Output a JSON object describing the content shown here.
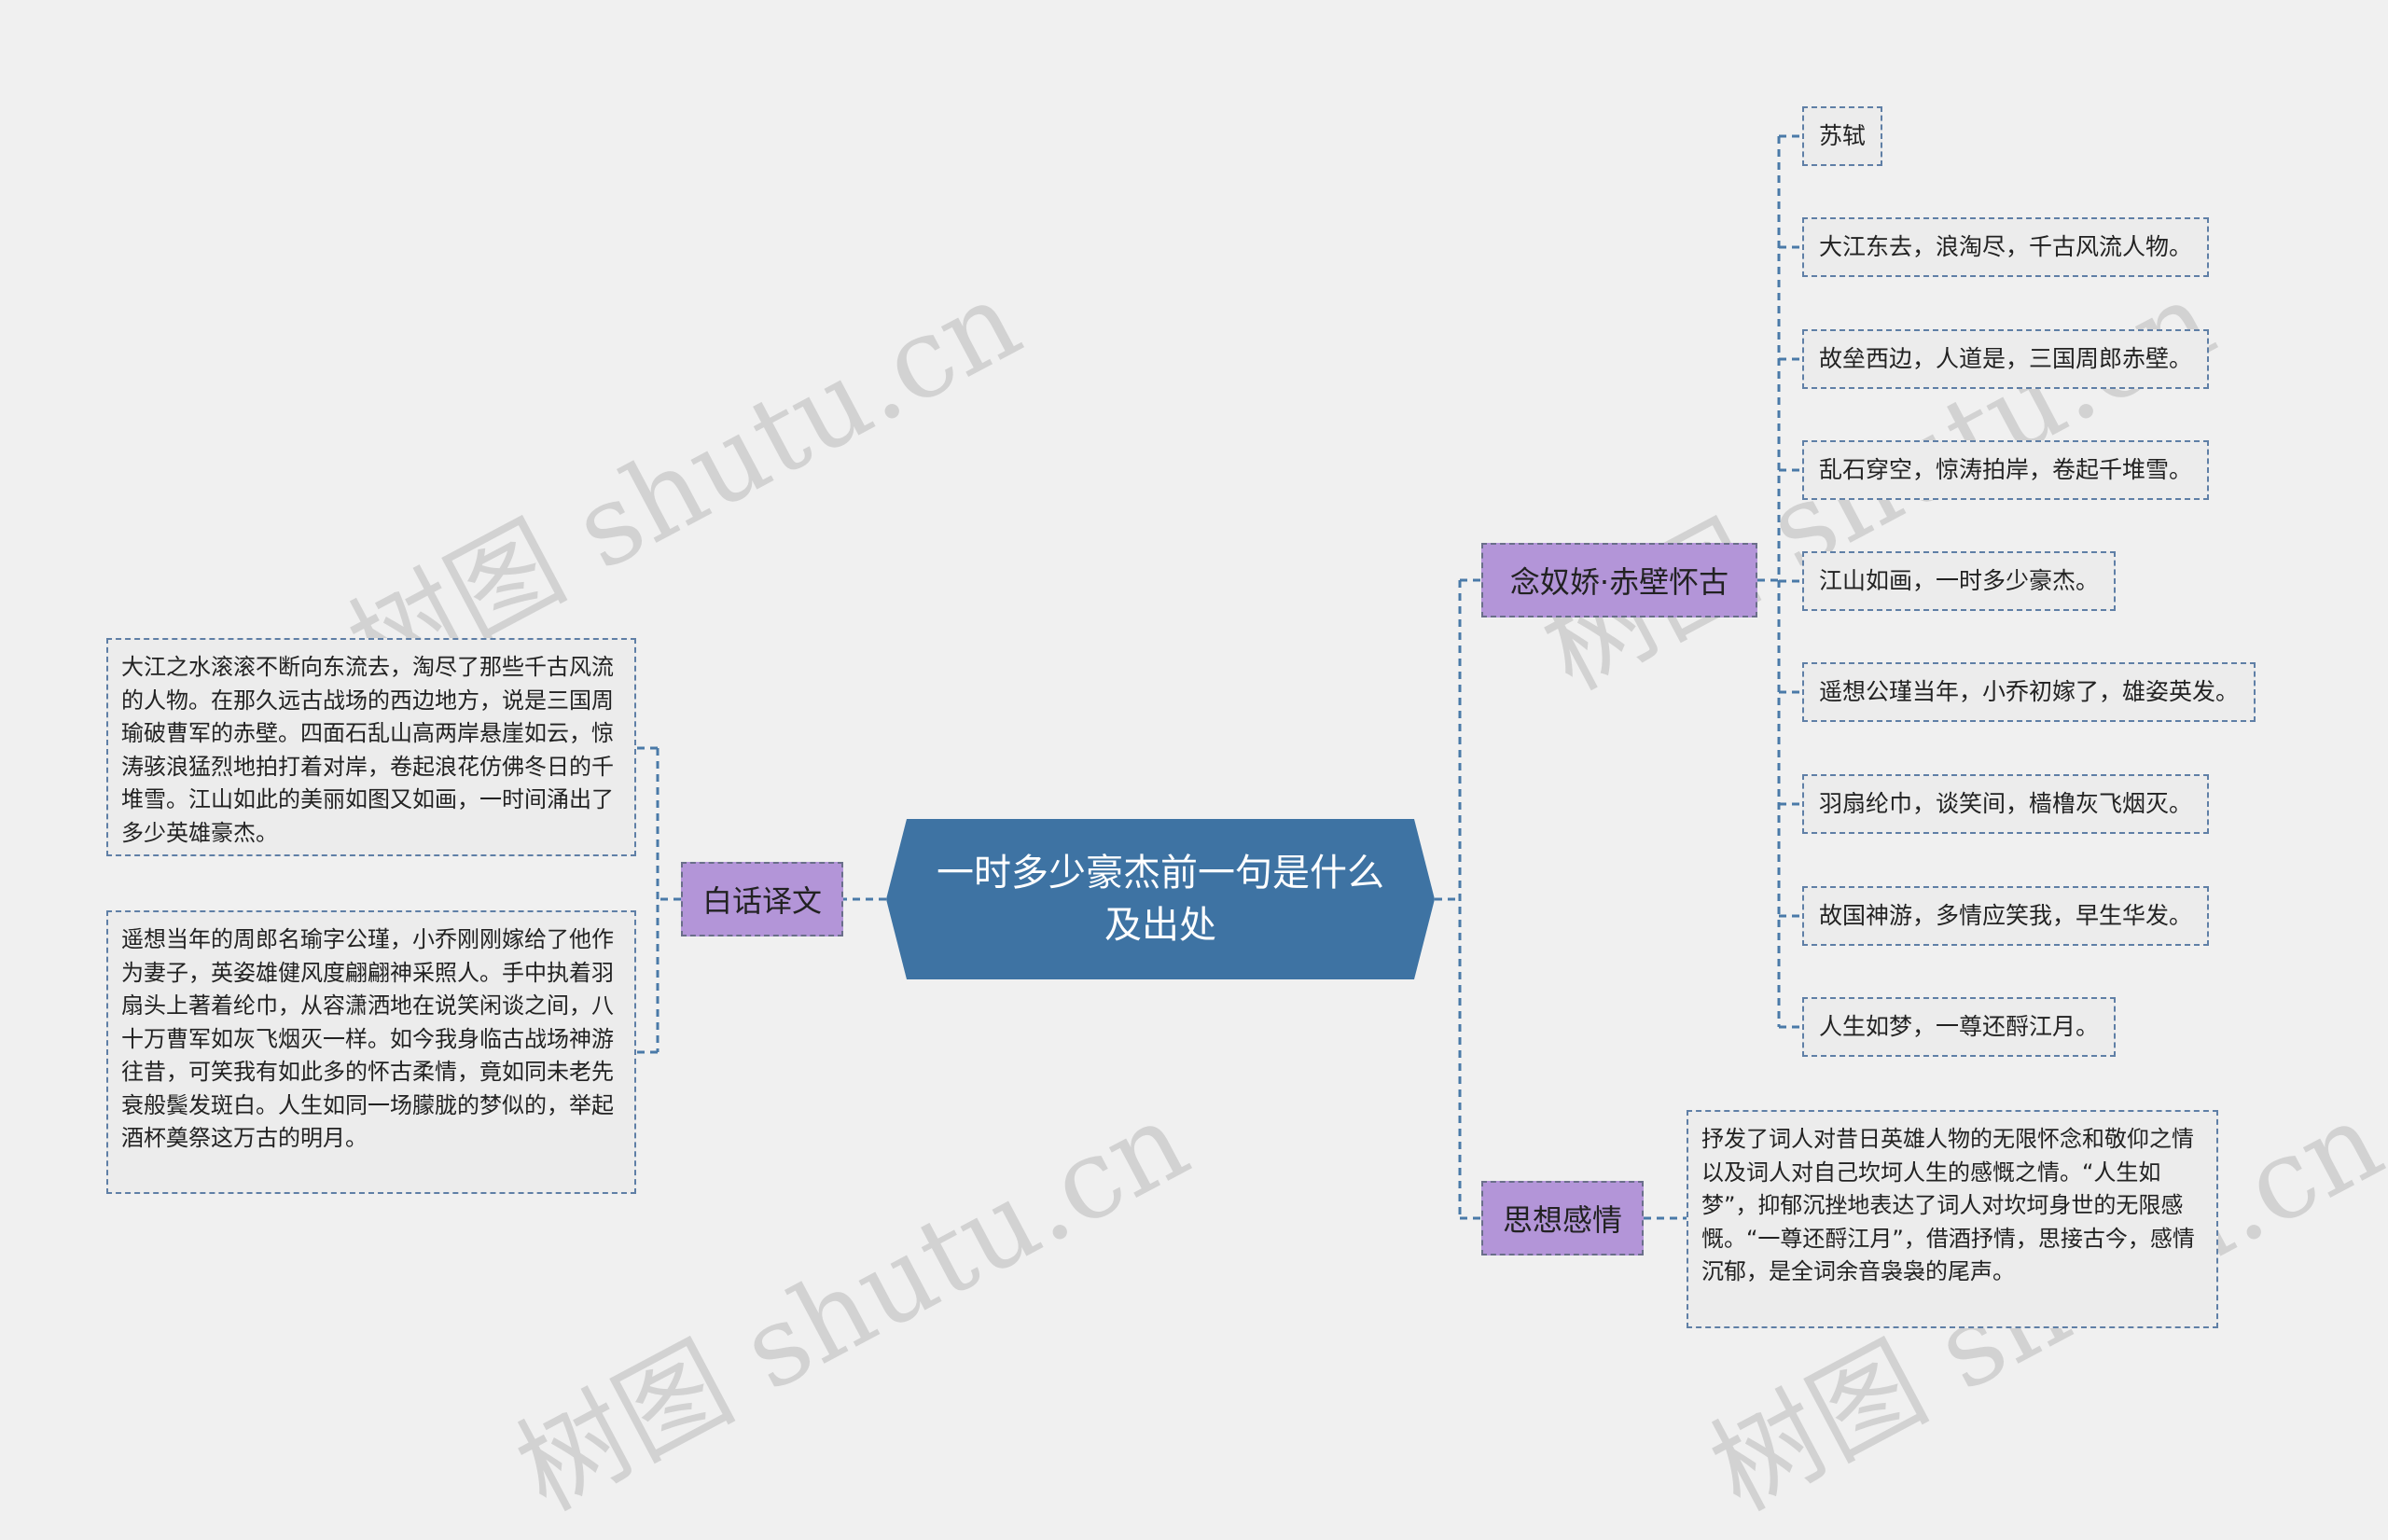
{
  "watermark": "树图 shutu.cn",
  "root": {
    "title": "一时多少豪杰前一句是什么及出处"
  },
  "branches": {
    "poem": {
      "label": "念奴娇·赤壁怀古",
      "lines": [
        "苏轼",
        "大江东去，浪淘尽，千古风流人物。",
        "故垒西边，人道是，三国周郎赤壁。",
        "乱石穿空，惊涛拍岸，卷起千堆雪。",
        "江山如画，一时多少豪杰。",
        "遥想公瑾当年，小乔初嫁了，雄姿英发。",
        "羽扇纶巾，谈笑间，樯橹灰飞烟灭。",
        "故国神游，多情应笑我，早生华发。",
        "人生如梦，一尊还酹江月。"
      ]
    },
    "emotion": {
      "label": "思想感情",
      "text": "抒发了词人对昔日英雄人物的无限怀念和敬仰之情以及词人对自己坎坷人生的感慨之情。“人生如梦”，抑郁沉挫地表达了词人对坎坷身世的无限感慨。“一尊还酹江月”，借酒抒情，思接古今，感情沉郁，是全词余音袅袅的尾声。"
    },
    "translation": {
      "label": "白话译文",
      "paragraphs": [
        "大江之水滚滚不断向东流去，淘尽了那些千古风流的人物。在那久远古战场的西边地方，说是三国周瑜破曹军的赤壁。四面石乱山高两岸悬崖如云，惊涛骇浪猛烈地拍打着对岸，卷起浪花仿佛冬日的千堆雪。江山如此的美丽如图又如画，一时间涌出了多少英雄豪杰。",
        "遥想当年的周郎名瑜字公瑾，小乔刚刚嫁给了他作为妻子，英姿雄健风度翩翩神采照人。手中执着羽扇头上著着纶巾，从容潇洒地在说笑闲谈之间，八十万曹军如灰飞烟灭一样。如今我身临古战场神游往昔，可笑我有如此多的怀古柔情，竟如同未老先衰般鬓发斑白。人生如同一场朦胧的梦似的，举起酒杯奠祭这万古的明月。"
      ]
    }
  },
  "colors": {
    "root": "#3e73a3",
    "branch": "#b395d8",
    "leaf_bg": "#ececec",
    "connector": "#4a7aa8"
  }
}
